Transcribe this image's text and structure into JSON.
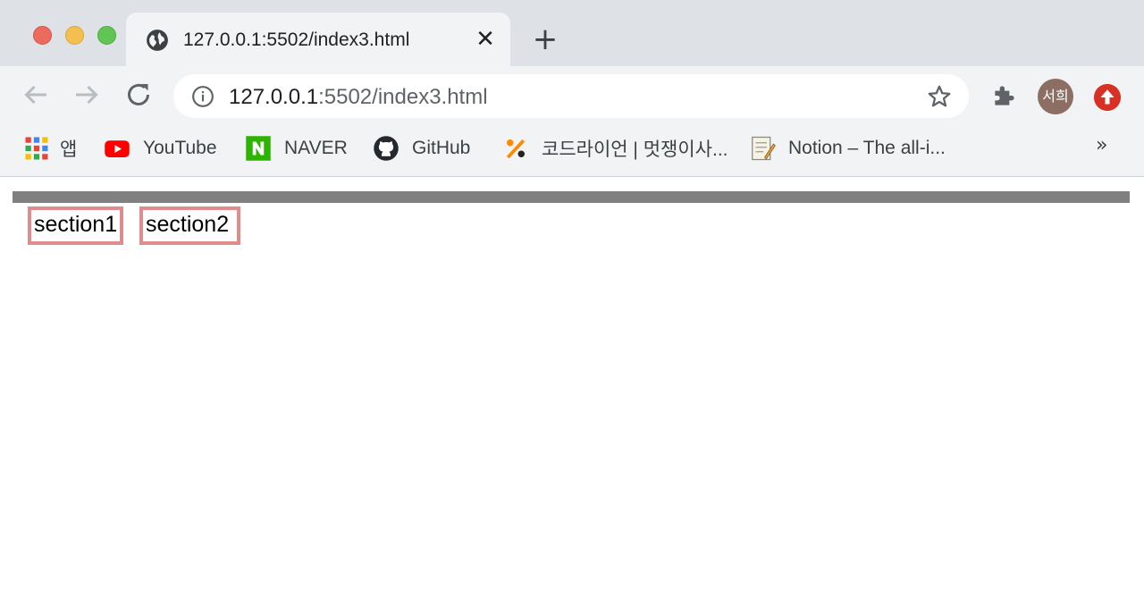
{
  "tab": {
    "title": "127.0.0.1:5502/index3.html",
    "close_glyph": "✕",
    "new_tab_glyph": "+"
  },
  "toolbar": {
    "url_host": "127.0.0.1",
    "url_rest": ":5502/index3.html",
    "profile_initials": "서희"
  },
  "bookmarks": [
    {
      "label": "앱",
      "icon": "apps-grid-icon"
    },
    {
      "label": "YouTube",
      "icon": "youtube-icon"
    },
    {
      "label": "NAVER",
      "icon": "naver-icon"
    },
    {
      "label": "GitHub",
      "icon": "github-icon"
    },
    {
      "label": "코드라이언 | 멋쟁이사...",
      "icon": "coderion-icon"
    },
    {
      "label": "Notion – The all-i...",
      "icon": "notion-icon"
    }
  ],
  "bookmarks_overflow": "»",
  "page": {
    "sections": [
      "section1",
      "section2"
    ]
  },
  "colors": {
    "tabstrip": "#dee1e6",
    "toolbar": "#f1f3f4",
    "section_border": "#e08c8c",
    "gray_bar": "#808080"
  }
}
